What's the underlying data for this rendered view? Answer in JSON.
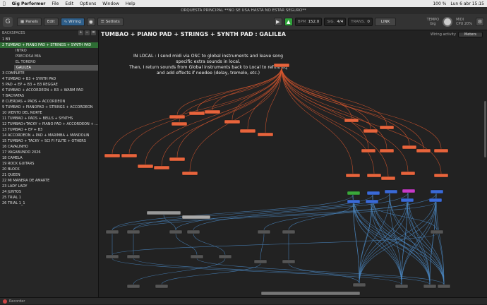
{
  "menubar": {
    "apple": "",
    "app_name": "Gig Performer",
    "items": [
      "File",
      "Edit",
      "Options",
      "Window",
      "Help"
    ],
    "status": {
      "battery": "100 %",
      "datetime": "Lun 6 abr 15:15"
    }
  },
  "window_title": "ORQUESTA PRINCIPAL **NO SE USA HASTA NO ESTAR SEGURO**",
  "toolbar": {
    "panels_label": "Panels",
    "edit_label": "Edit",
    "wiring_label": "Wiring",
    "setlists_label": "Setlists",
    "bpm_label": "BPM",
    "bpm_value": "152.0",
    "sig_label": "SIG.",
    "sig_value": "4/4",
    "trans_label": "TRANS.",
    "trans_value": "0",
    "link_label": "LINK",
    "tempo_label": "TEMPO",
    "tempo_sub": "Gig",
    "midi_label": "MIDI",
    "cpu_label": "CPU",
    "cpu_value": "20%"
  },
  "sidebar": {
    "header": "BACKSPACES",
    "items": [
      {
        "label": "1  B3",
        "state": "normal"
      },
      {
        "label": "2  TUMBAO + PIANO PAD + STRINGS + SYNTH PAD",
        "state": "selected"
      },
      {
        "label": "INTRO",
        "state": "sub"
      },
      {
        "label": "PRECIOSA MIA",
        "state": "sub"
      },
      {
        "label": "EL TORERO",
        "state": "sub"
      },
      {
        "label": "GALILEA",
        "state": "subselected"
      },
      {
        "label": "3  COMPLETE",
        "state": "normal"
      },
      {
        "label": "4  TUMBAO + B3 + SYNTH PAD",
        "state": "normal"
      },
      {
        "label": "5  PAD + EP + B3 + B3 REGGAE",
        "state": "normal"
      },
      {
        "label": "6  TUMBAO + ACCORDEON + B3 + WARM PAD",
        "state": "normal"
      },
      {
        "label": "7  BACHATAS",
        "state": "normal"
      },
      {
        "label": "8  CUERDAS + PADS + ACCORDEON",
        "state": "normal"
      },
      {
        "label": "9  TUMBAO + PIANOPAD + STRINGS + ACCORDEON",
        "state": "normal"
      },
      {
        "label": "10  VIENTO DEL NORTE",
        "state": "normal"
      },
      {
        "label": "11  TUMBAO + PADS + BELLS + SYNTHS",
        "state": "normal"
      },
      {
        "label": "12  TUMBAO+TACKY + PIANO PAD + ACCORDEON + ...",
        "state": "normal"
      },
      {
        "label": "13  TUMBAO + EP + B3",
        "state": "normal"
      },
      {
        "label": "14  ACCORDEON + PAD + MARIMBA + MANDOLIN",
        "state": "normal"
      },
      {
        "label": "15  TUMBAO + TACKY + SCI FI FLUTE + OTHERS",
        "state": "normal"
      },
      {
        "label": "16  CAVALINHO",
        "state": "normal"
      },
      {
        "label": "17  VAGABUNDO 2026",
        "state": "normal"
      },
      {
        "label": "18  CAMELA",
        "state": "normal"
      },
      {
        "label": "19  ROCK GUITARS",
        "state": "normal"
      },
      {
        "label": "20  BLOCK",
        "state": "normal"
      },
      {
        "label": "21  QUEEN",
        "state": "normal"
      },
      {
        "label": "22  MI MANERA DE AMARTE",
        "state": "normal"
      },
      {
        "label": "23  LADY LADY",
        "state": "normal"
      },
      {
        "label": "24  JUNTOS",
        "state": "normal"
      },
      {
        "label": "25  TRIAL 1",
        "state": "normal"
      },
      {
        "label": "26  TRIAL 1_1",
        "state": "normal"
      }
    ]
  },
  "canvas": {
    "title": "TUMBAO + PIANO PAD + STRINGS + SYNTH PAD : GALILEA",
    "wiring_activity_label": "Wiring activity",
    "wiring_activity_value": "Meters",
    "note_lines": [
      "IN LOCAL : I send midi via OSC to global instruments and leave song",
      "specific extra sounds in local.",
      "Then, I return sounds from Global instruments back to Local to refine eq",
      "and add effects if needee (delay, tremelo, etc.)"
    ],
    "colors": {
      "midi_block": "#e8643c",
      "audio_wire": "#4a86c0",
      "midi_wire": "#d9572e",
      "selected": "#2e6e34"
    }
  },
  "statusbar": {
    "recorder_label": "Recorder"
  }
}
